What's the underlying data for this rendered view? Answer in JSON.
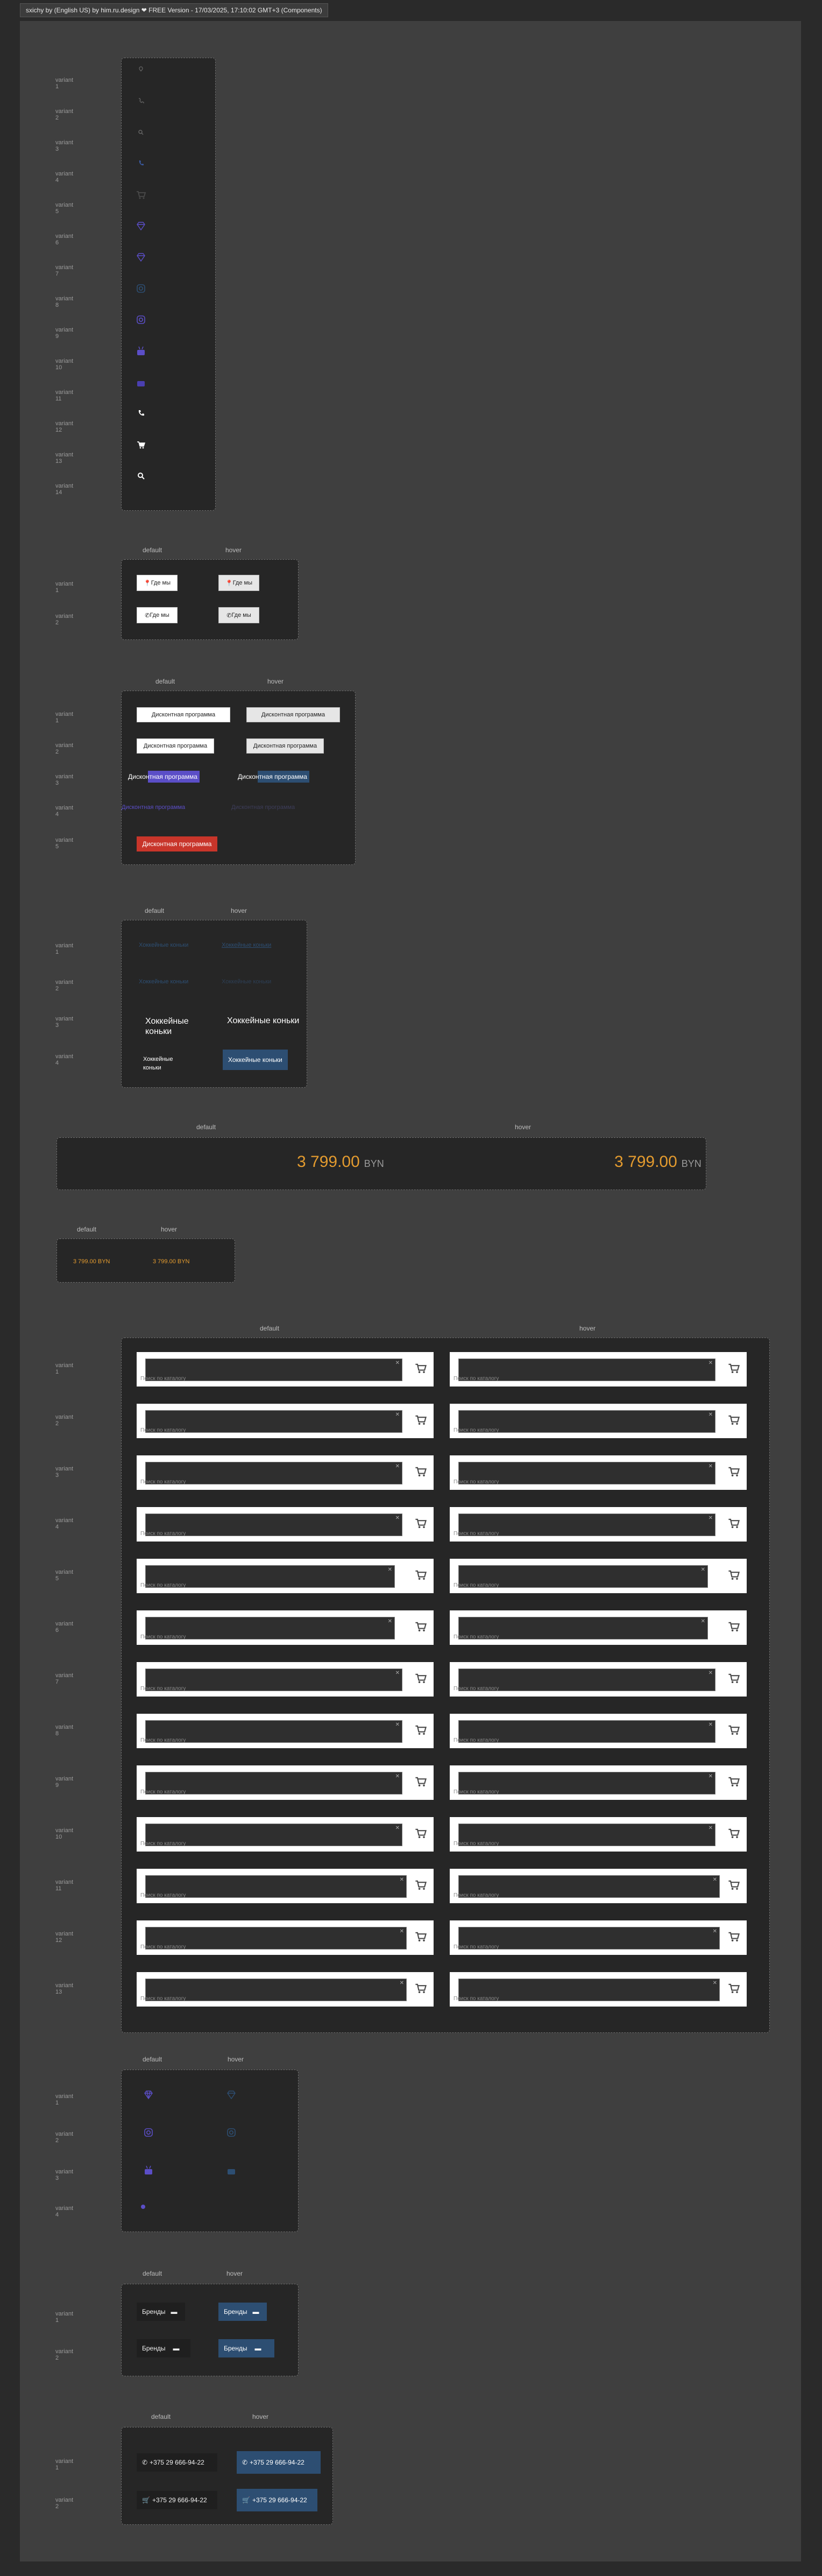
{
  "header": {
    "title": "sxichy by (English US) by him.ru.design ❤ FREE Version - 17/03/2025, 17:10:02 GMT+3 (Components)"
  },
  "common": {
    "variant": "variant",
    "default": "default",
    "hover": "hover"
  },
  "icons_list": {
    "nums": [
      "1",
      "2",
      "3",
      "4",
      "5",
      "6",
      "7",
      "8",
      "9",
      "10",
      "11",
      "12",
      "13",
      "14"
    ],
    "icons": [
      "pin-icon",
      "phone-icon",
      "search-icon",
      "phone-icon",
      "cart-icon",
      "diamond-icon",
      "diamond-icon",
      "instagram-icon",
      "instagram-icon",
      "youtube-icon",
      "youtube-icon",
      "phone-icon",
      "cart-icon",
      "search-icon"
    ]
  },
  "where_buttons": {
    "label": "Где мы"
  },
  "discount": {
    "label": "Дисконтная программа"
  },
  "hockey": {
    "small_label": "Хоккейные коньки",
    "big_label": "Хоккейные коньки"
  },
  "price": {
    "value": "3 799.00",
    "currency": "BYN",
    "small": "3 799.00 BYN"
  },
  "search": {
    "placeholder": "Поиск по каталогу",
    "rows": 13
  },
  "social": {
    "nums": [
      "1",
      "2",
      "3",
      "4"
    ]
  },
  "brands": {
    "label": "Бренды"
  },
  "contacts": {
    "phone": "+375 29 666-94-22"
  },
  "colors": {
    "accent": "#e39b2f",
    "blue": "#2d4e72",
    "purple": "#5b4ec7",
    "red": "#c8352a"
  }
}
